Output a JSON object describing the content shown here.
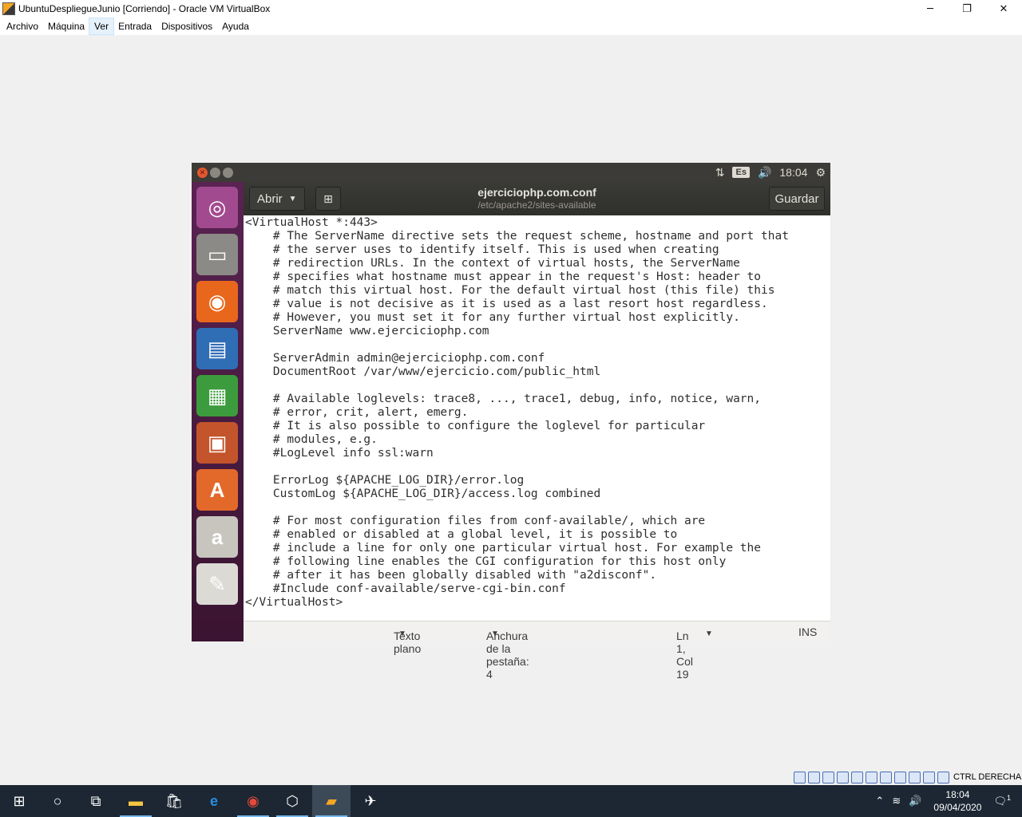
{
  "host_window": {
    "title": "UbuntuDespliegueJunio [Corriendo] - Oracle VM VirtualBox",
    "controls": {
      "minimize": "─",
      "restore": "❐",
      "close": "✕"
    }
  },
  "host_menu": [
    {
      "label": "Archivo",
      "active": false
    },
    {
      "label": "Máquina",
      "active": false
    },
    {
      "label": "Ver",
      "active": true
    },
    {
      "label": "Entrada",
      "active": false
    },
    {
      "label": "Dispositivos",
      "active": false
    },
    {
      "label": "Ayuda",
      "active": false
    }
  ],
  "guest_panel": {
    "keyboard_layout": "Es",
    "clock": "18:04",
    "icons": {
      "network": "⇅",
      "volume": "🔊",
      "settings": "⚙"
    }
  },
  "launcher": [
    {
      "name": "ubuntu-dash-icon",
      "glyph": "◎",
      "color": "#a24a8f"
    },
    {
      "name": "files-icon",
      "glyph": "▭",
      "color": "#8b8a86"
    },
    {
      "name": "firefox-icon",
      "glyph": "◉",
      "color": "#e8671c"
    },
    {
      "name": "writer-icon",
      "glyph": "▤",
      "color": "#2f6db5"
    },
    {
      "name": "calc-icon",
      "glyph": "▦",
      "color": "#3c9b3c"
    },
    {
      "name": "impress-icon",
      "glyph": "▣",
      "color": "#c4542b"
    },
    {
      "name": "software-center-icon",
      "glyph": "A",
      "color": "#e3692b"
    },
    {
      "name": "amazon-icon",
      "glyph": "a",
      "color": "#c7c5bd"
    },
    {
      "name": "text-editor-icon",
      "glyph": "✎",
      "color": "#dcdad5"
    }
  ],
  "gedit": {
    "open_button": "Abrir",
    "file_name": "ejerciciophp.com.conf",
    "file_path": "/etc/apache2/sites-available",
    "save_button": "Guardar",
    "content": "<VirtualHost *:443>\n    # The ServerName directive sets the request scheme, hostname and port that\n    # the server uses to identify itself. This is used when creating\n    # redirection URLs. In the context of virtual hosts, the ServerName\n    # specifies what hostname must appear in the request's Host: header to\n    # match this virtual host. For the default virtual host (this file) this\n    # value is not decisive as it is used as a last resort host regardless.\n    # However, you must set it for any further virtual host explicitly.\n    ServerName www.ejerciciophp.com\n\n    ServerAdmin admin@ejerciciophp.com.conf\n    DocumentRoot /var/www/ejercicio.com/public_html\n\n    # Available loglevels: trace8, ..., trace1, debug, info, notice, warn,\n    # error, crit, alert, emerg.\n    # It is also possible to configure the loglevel for particular\n    # modules, e.g.\n    #LogLevel info ssl:warn\n\n    ErrorLog ${APACHE_LOG_DIR}/error.log\n    CustomLog ${APACHE_LOG_DIR}/access.log combined\n\n    # For most configuration files from conf-available/, which are\n    # enabled or disabled at a global level, it is possible to\n    # include a line for only one particular virtual host. For example the\n    # following line enables the CGI configuration for this host only\n    # after it has been globally disabled with \"a2disconf\".\n    #Include conf-available/serve-cgi-bin.conf\n</VirtualHost>",
    "status": {
      "language": "Texto plano",
      "tab_width": "Anchura de la pestaña: 4",
      "cursor": "Ln 1, Col 19",
      "mode": "INS"
    }
  },
  "vbox_status": {
    "host_key": "CTRL DERECHA"
  },
  "taskbar": {
    "time": "18:04",
    "date": "09/04/2020",
    "notification_count": "1"
  }
}
